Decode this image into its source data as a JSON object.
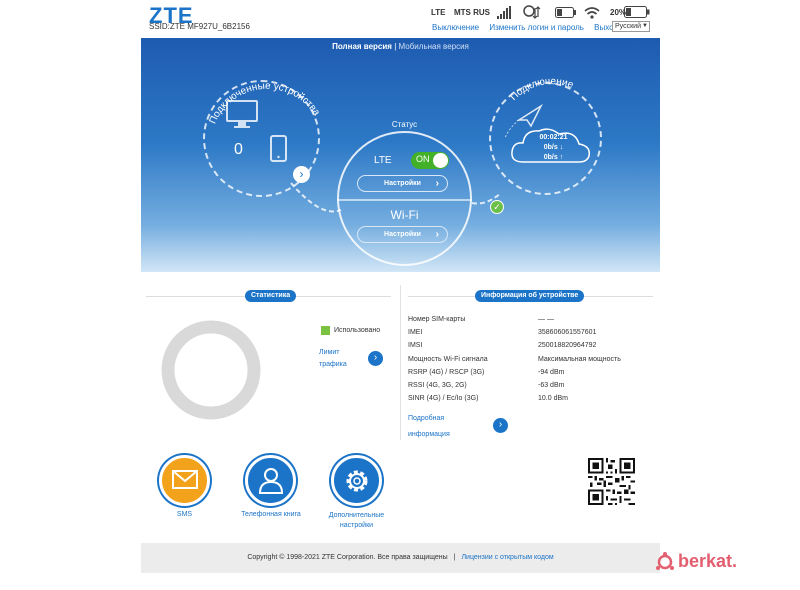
{
  "header": {
    "logo": "ZTE",
    "ssid": "SSID:ZTE MF927U_6B2156",
    "network_type": "LTE",
    "operator": "MTS RUS",
    "battery_percent": "20%",
    "links": {
      "logout": "Выключение",
      "change_login": "Изменить логин и пароль",
      "exit": "Выход"
    },
    "language": "Русский"
  },
  "view_switch": {
    "full": "Полная версия",
    "separator": "|",
    "mobile": "Мобильная версия"
  },
  "devices": {
    "title": "Подключенные устройства",
    "count": "0"
  },
  "status": {
    "title": "Статус",
    "lte_label": "LTE",
    "lte_toggle": "ON",
    "lte_settings": "Настройки",
    "wifi_label": "Wi-Fi",
    "wifi_settings": "Настройки"
  },
  "connection": {
    "title": "Подключение",
    "time": "00:02:21",
    "down": "0b/s ↓",
    "up": "0b/s ↑"
  },
  "statistics": {
    "title": "Статистика",
    "legend_used": "Использовано",
    "limit_link_1": "Лимит",
    "limit_link_2": "трафика",
    "used_color": "#7cc242"
  },
  "device_info": {
    "title": "Информация об устройстве",
    "rows": [
      {
        "key": "Номер SIM-карты",
        "value": "— —"
      },
      {
        "key": "IMEI",
        "value": "358606061557601"
      },
      {
        "key": "IMSI",
        "value": "250018820964792"
      },
      {
        "key": "Мощность Wi-Fi сигнала",
        "value": "Максимальная мощность"
      },
      {
        "key": "RSRP (4G) / RSCP (3G)",
        "value": "-94 dBm"
      },
      {
        "key": "RSSI (4G, 3G, 2G)",
        "value": "-63 dBm"
      },
      {
        "key": "SINR (4G) / Ec/Io (3G)",
        "value": "10.0 dBm"
      }
    ],
    "more_1": "Подробная",
    "more_2": "информация"
  },
  "shortcuts": {
    "sms": "SMS",
    "phonebook": "Телефонная книга",
    "settings_1": "Дополнительные",
    "settings_2": "настройки"
  },
  "footer": {
    "copyright": "Copyright © 1998-2021 ZTE Corporation. Все права защищены",
    "sep": "|",
    "license": "Лицензии с открытым кодом"
  },
  "watermark": "berkat.",
  "colors": {
    "accent": "#1b74c8",
    "sms": "#f2a21b",
    "on": "#43b02a"
  },
  "icons": [
    "signal-icon",
    "data-icon",
    "battery-icon",
    "wifi-icon",
    "monitor-icon",
    "phone-icon",
    "plane-icon",
    "cloud-icon",
    "check-icon",
    "envelope-icon",
    "user-icon",
    "gear-icon"
  ]
}
